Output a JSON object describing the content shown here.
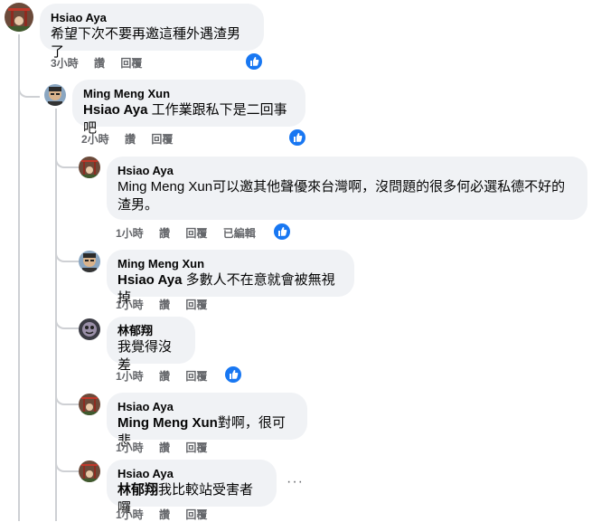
{
  "ui": {
    "like_color": "#1877f2",
    "bubble_color": "#f0f2f5"
  },
  "comments": [
    {
      "author": "Hsiao Aya",
      "mention": "",
      "text": "希望下次不要再邀這種外遇渣男了",
      "time": "3小時",
      "like": "讚",
      "reply": "回覆",
      "edited": "",
      "reacted": true
    },
    {
      "author": "Ming Meng Xun",
      "mention": "Hsiao Aya",
      "text": " 工作業跟私下是二回事吧",
      "time": "2小時",
      "like": "讚",
      "reply": "回覆",
      "edited": "",
      "reacted": true
    },
    {
      "author": "Hsiao Aya",
      "mention": "Ming Meng Xun",
      "text": "可以邀其他聲優來台灣啊，沒問題的很多何必選私德不好的渣男。",
      "time": "1小時",
      "like": "讚",
      "reply": "回覆",
      "edited": "已編輯",
      "reacted": true
    },
    {
      "author": "Ming Meng Xun",
      "mention": "Hsiao Aya",
      "text": " 多數人不在意就會被無視掉",
      "time": "1小時",
      "like": "讚",
      "reply": "回覆",
      "edited": "",
      "reacted": false
    },
    {
      "author": "林郁翔",
      "mention": "",
      "text": "我覺得沒差",
      "time": "1小時",
      "like": "讚",
      "reply": "回覆",
      "edited": "",
      "reacted": true
    },
    {
      "author": "Hsiao Aya",
      "mention": "Ming Meng Xun",
      "text": "對啊，很可悲",
      "time": "1小時",
      "like": "讚",
      "reply": "回覆",
      "edited": "",
      "reacted": false
    },
    {
      "author": "Hsiao Aya",
      "mention": "林郁翔",
      "text": "我比較站受害者囉",
      "time": "1小時",
      "like": "讚",
      "reply": "回覆",
      "edited": "",
      "reacted": false
    }
  ],
  "more_icon": "···"
}
